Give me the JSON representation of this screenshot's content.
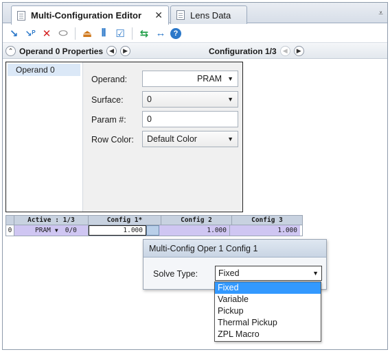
{
  "tabs": [
    {
      "label": "Multi-Configuration Editor",
      "active": true
    },
    {
      "label": "Lens Data",
      "active": false
    }
  ],
  "toolbar": {
    "icons": [
      "insert-operand-icon",
      "insert-operand-after-icon",
      "delete-operand-icon",
      "configuration-icon",
      "lens-icon",
      "columns-icon",
      "chart-icon",
      "refresh-icon",
      "arrows-icon",
      "help-icon"
    ]
  },
  "header": {
    "operand_title": "Operand 0 Properties",
    "config_title": "Configuration 1/3"
  },
  "operand_list": [
    "Operand 0"
  ],
  "form": {
    "operand_label": "Operand:",
    "operand_value": "PRAM",
    "surface_label": "Surface:",
    "surface_value": "0",
    "param_label": "Param #:",
    "param_value": "0",
    "rowcolor_label": "Row Color:",
    "rowcolor_value": "Default Color"
  },
  "grid": {
    "headers": [
      "Active : 1/3",
      "Config 1*",
      "Config 2",
      "Config 3"
    ],
    "row": {
      "num": "0",
      "operand": "PRAM",
      "surface_param": "0/0",
      "values": [
        "1.000",
        "1.000",
        "1.000"
      ]
    }
  },
  "popup": {
    "title": "Multi-Config Oper 1 Config 1",
    "solve_label": "Solve Type:",
    "solve_value": "Fixed",
    "options": [
      "Fixed",
      "Variable",
      "Pickup",
      "Thermal Pickup",
      "ZPL Macro"
    ]
  },
  "colors": {
    "selection": "#3399ff",
    "grid_fill": "#cfc6f2",
    "header_fill": "#c8d2e0"
  }
}
